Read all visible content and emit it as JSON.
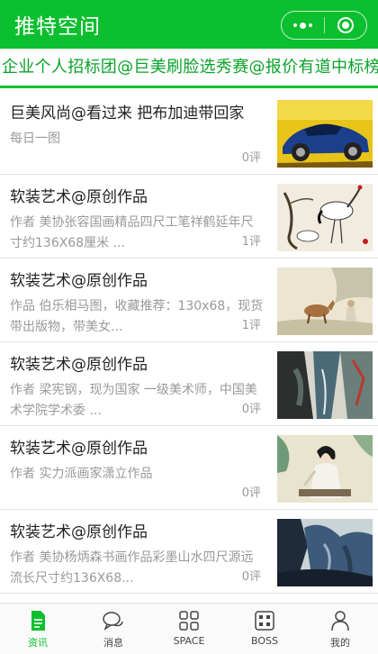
{
  "header": {
    "title": "推特空间"
  },
  "marquee": {
    "text": "企业个人招标团@巨美刷脸选秀赛@报价有道中标榜"
  },
  "feed": [
    {
      "title": "巨美风尚@看过来 把布加迪带回家",
      "desc": "每日一图",
      "count": "0评",
      "thumb": "car"
    },
    {
      "title": "软装艺术@原创作品",
      "desc": "作者 美协张容国画精品四尺工笔祥鹤延年尺寸约136X68厘米 ...",
      "count": "1评",
      "thumb": "cranes"
    },
    {
      "title": "软装艺术@原创作品",
      "desc": "作品 伯乐相马图，收藏推荐：130x68，现货带出版物，带美女...",
      "count": "1评",
      "thumb": "horse"
    },
    {
      "title": "软装艺术@原创作品",
      "desc": "作者 梁宪钢，现为国家 一级美术师，中国美术学院学术委 ...",
      "count": "0评",
      "thumb": "landscape"
    },
    {
      "title": "软装艺术@原创作品",
      "desc": "作者 实力派画家潇立作品",
      "count": "0评",
      "thumb": "lady"
    },
    {
      "title": "软装艺术@原创作品",
      "desc": "作者 美协杨炳森书画作品彩墨山水四尺源远流长尺寸约136X68...",
      "count": "0评",
      "thumb": "mountains"
    }
  ],
  "tabbar": {
    "items": [
      {
        "label": "资讯",
        "icon": "document-icon",
        "active": true
      },
      {
        "label": "消息",
        "icon": "chat-icon",
        "active": false
      },
      {
        "label": "SPACE",
        "icon": "grid-icon",
        "active": false
      },
      {
        "label": "BOSS",
        "icon": "boss-icon",
        "active": false
      },
      {
        "label": "我的",
        "icon": "user-icon",
        "active": false
      }
    ]
  },
  "colors": {
    "brand": "#0cbf2f",
    "marquee_text": "#0aa22a",
    "muted_text": "#999999"
  }
}
